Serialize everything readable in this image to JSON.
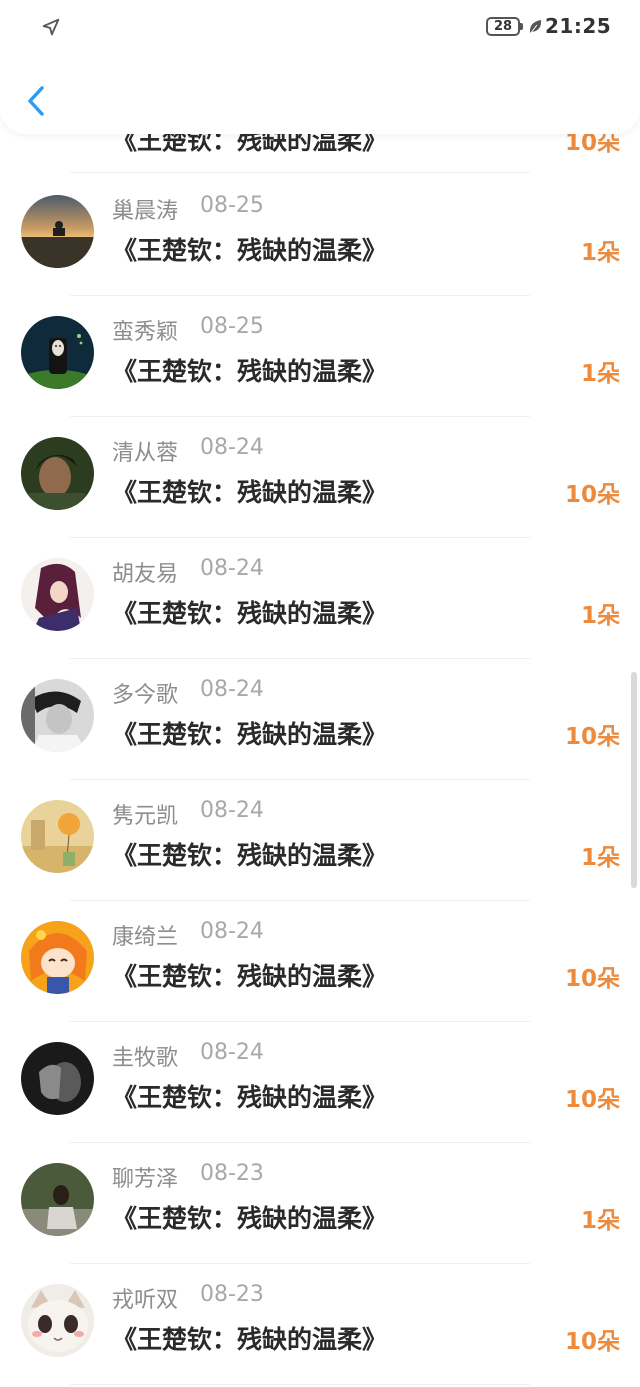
{
  "status_bar": {
    "battery": "28",
    "time": "21:25"
  },
  "rows": [
    {
      "name": "",
      "date": "",
      "title": "《王楚钦：残缺的温柔》",
      "amount": "10朵",
      "avatar": "avatar-partial"
    },
    {
      "name": "巢晨涛",
      "date": "08-25",
      "title": "《王楚钦：残缺的温柔》",
      "amount": "1朵",
      "avatar": "avatar-sunset-rider"
    },
    {
      "name": "蛮秀颖",
      "date": "08-25",
      "title": "《王楚钦：残缺的温柔》",
      "amount": "1朵",
      "avatar": "avatar-masked-figure"
    },
    {
      "name": "清从蓉",
      "date": "08-24",
      "title": "《王楚钦：残缺的温柔》",
      "amount": "10朵",
      "avatar": "avatar-woman-portrait"
    },
    {
      "name": "胡友易",
      "date": "08-24",
      "title": "《王楚钦：残缺的温柔》",
      "amount": "1朵",
      "avatar": "avatar-anime-warrior"
    },
    {
      "name": "多今歌",
      "date": "08-24",
      "title": "《王楚钦：残缺的温柔》",
      "amount": "10朵",
      "avatar": "avatar-bw-boy"
    },
    {
      "name": "隽元凯",
      "date": "08-24",
      "title": "《王楚钦：残缺的温柔》",
      "amount": "1朵",
      "avatar": "avatar-balloon-room"
    },
    {
      "name": "康绮兰",
      "date": "08-24",
      "title": "《王楚钦：残缺的温柔》",
      "amount": "10朵",
      "avatar": "avatar-cartoon-girl"
    },
    {
      "name": "圭牧歌",
      "date": "08-24",
      "title": "《王楚钦：残缺的温柔》",
      "amount": "10朵",
      "avatar": "avatar-dark-hand"
    },
    {
      "name": "聊芳泽",
      "date": "08-23",
      "title": "《王楚钦：残缺的温柔》",
      "amount": "1朵",
      "avatar": "avatar-girl-outdoors"
    },
    {
      "name": "戎听双",
      "date": "08-23",
      "title": "《王楚钦：残缺的温柔》",
      "amount": "10朵",
      "avatar": "avatar-cat"
    }
  ],
  "colors": {
    "accent_orange": "#ee8a3c",
    "back_blue": "#2a9df4",
    "name_gray": "#8d8d8d",
    "title_dark": "#2a2a2a"
  },
  "icons": {
    "location": "location-arrow-icon",
    "leaf": "leaf-icon",
    "back": "chevron-left-icon"
  }
}
